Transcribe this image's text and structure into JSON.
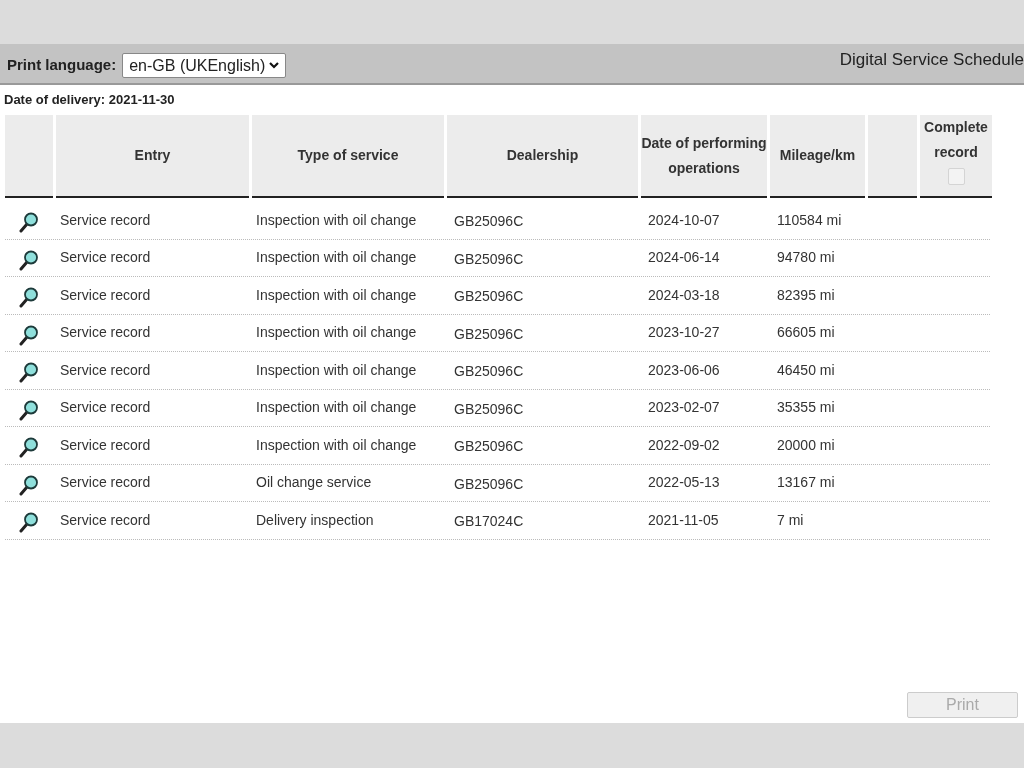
{
  "header": {
    "language_label": "Print language:",
    "language_value": "en-GB (UKEnglish)",
    "title": "Digital Service Schedule"
  },
  "delivery": "Date of delivery: 2021-11-30",
  "table": {
    "columns": [
      "",
      "Entry",
      "Type of service",
      "Dealership",
      "Date of performing operations",
      "Mileage/km",
      "",
      "Complete record"
    ],
    "complete_checkbox": {
      "checked": false,
      "disabled": true
    },
    "rows": [
      {
        "entry": "Service record",
        "type": "Inspection with oil change",
        "dealership": "GB25096C",
        "date": "2024-10-07",
        "mileage": "110584 mi"
      },
      {
        "entry": "Service record",
        "type": "Inspection with oil change",
        "dealership": "GB25096C",
        "date": "2024-06-14",
        "mileage": "94780 mi"
      },
      {
        "entry": "Service record",
        "type": "Inspection with oil change",
        "dealership": "GB25096C",
        "date": "2024-03-18",
        "mileage": "82395 mi"
      },
      {
        "entry": "Service record",
        "type": "Inspection with oil change",
        "dealership": "GB25096C",
        "date": "2023-10-27",
        "mileage": "66605 mi"
      },
      {
        "entry": "Service record",
        "type": "Inspection with oil change",
        "dealership": "GB25096C",
        "date": "2023-06-06",
        "mileage": "46450 mi"
      },
      {
        "entry": "Service record",
        "type": "Inspection with oil change",
        "dealership": "GB25096C",
        "date": "2023-02-07",
        "mileage": "35355 mi"
      },
      {
        "entry": "Service record",
        "type": "Inspection with oil change",
        "dealership": "GB25096C",
        "date": "2022-09-02",
        "mileage": "20000 mi"
      },
      {
        "entry": "Service record",
        "type": "Oil change service",
        "dealership": "GB25096C",
        "date": "2022-05-13",
        "mileage": "13167 mi"
      },
      {
        "entry": "Service record",
        "type": "Delivery inspection",
        "dealership": "GB17024C",
        "date": "2021-11-05",
        "mileage": "7 mi"
      }
    ]
  },
  "print_button": {
    "label": "Print",
    "disabled": true
  }
}
